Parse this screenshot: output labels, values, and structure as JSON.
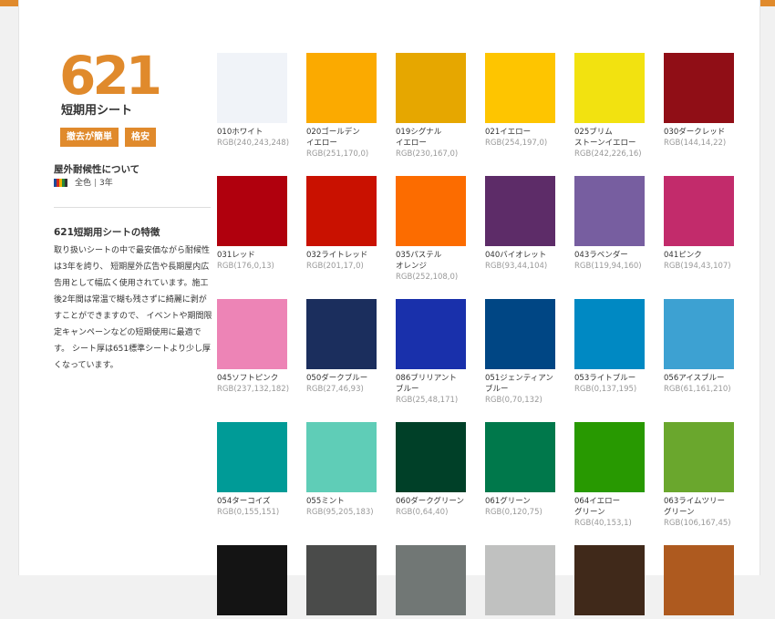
{
  "product": {
    "number": "621",
    "name": "短期用シート",
    "tags": [
      "撤去が簡単",
      "格安"
    ]
  },
  "weather": {
    "title": "屋外耐候性について",
    "colors": "全色",
    "years": "3年"
  },
  "feature": {
    "title": "621短期用シートの特徴",
    "text": "取り扱いシートの中で最安価ながら耐候性は3年を誇り、 短期屋外広告や長期屋内広告用として幅広く使用されています。施工後2年間は常温で糊も残さずに綺麗に剥がすことができますので、 イベントや期間限定キャンペーンなどの短期使用に最適です。 シート厚は651標準シートより少し厚くなっています。"
  },
  "swatches": [
    {
      "name": "010ホワイト",
      "rgb": "RGB(240,243,248)",
      "color": "#f0f3f8"
    },
    {
      "name": "020ゴールデン\nイエロー",
      "rgb": "RGB(251,170,0)",
      "color": "#fbaa00"
    },
    {
      "name": "019シグナル\nイエロー",
      "rgb": "RGB(230,167,0)",
      "color": "#e6a700"
    },
    {
      "name": "021イエロー",
      "rgb": "RGB(254,197,0)",
      "color": "#fec500"
    },
    {
      "name": "025ブリム\nストーンイエロー",
      "rgb": "RGB(242,226,16)",
      "color": "#f2e210"
    },
    {
      "name": "030ダークレッド",
      "rgb": "RGB(144,14,22)",
      "color": "#900e16"
    },
    {
      "name": "031レッド",
      "rgb": "RGB(176,0,13)",
      "color": "#b0000d"
    },
    {
      "name": "032ライトレッド",
      "rgb": "RGB(201,17,0)",
      "color": "#c91100"
    },
    {
      "name": "035パステル\nオレンジ",
      "rgb": "RGB(252,108,0)",
      "color": "#fc6c00"
    },
    {
      "name": "040バイオレット",
      "rgb": "RGB(93,44,104)",
      "color": "#5d2c68"
    },
    {
      "name": "043ラベンダー",
      "rgb": "RGB(119,94,160)",
      "color": "#775ea0"
    },
    {
      "name": "041ピンク",
      "rgb": "RGB(194,43,107)",
      "color": "#c22b6b"
    },
    {
      "name": "045ソフトピンク",
      "rgb": "RGB(237,132,182)",
      "color": "#ed84b6"
    },
    {
      "name": "050ダークブルー",
      "rgb": "RGB(27,46,93)",
      "color": "#1b2e5d"
    },
    {
      "name": "086ブリリアント\nブルー",
      "rgb": "RGB(25,48,171)",
      "color": "#1930ab"
    },
    {
      "name": "051ジェンティアン\nブルー",
      "rgb": "RGB(0,70,132)",
      "color": "#004684"
    },
    {
      "name": "053ライトブルー",
      "rgb": "RGB(0,137,195)",
      "color": "#0089c3"
    },
    {
      "name": "056アイスブルー",
      "rgb": "RGB(61,161,210)",
      "color": "#3da1d2"
    },
    {
      "name": "054ターコイズ",
      "rgb": "RGB(0,155,151)",
      "color": "#009b97"
    },
    {
      "name": "055ミント",
      "rgb": "RGB(95,205,183)",
      "color": "#5fcdb7"
    },
    {
      "name": "060ダークグリーン",
      "rgb": "RGB(0,64,40)",
      "color": "#004028"
    },
    {
      "name": "061グリーン",
      "rgb": "RGB(0,120,75)",
      "color": "#00784b"
    },
    {
      "name": "064イエロー\nグリーン",
      "rgb": "RGB(40,153,1)",
      "color": "#289901"
    },
    {
      "name": "063ライムツリー\nグリーン",
      "rgb": "RGB(106,167,45)",
      "color": "#6aa72d"
    },
    {
      "name": "",
      "rgb": "",
      "color": "#141414"
    },
    {
      "name": "",
      "rgb": "",
      "color": "#4a4b4a"
    },
    {
      "name": "",
      "rgb": "",
      "color": "#717775"
    },
    {
      "name": "",
      "rgb": "",
      "color": "#c0c1c0"
    },
    {
      "name": "",
      "rgb": "",
      "color": "#40291a"
    },
    {
      "name": "",
      "rgb": "",
      "color": "#ae5a1f"
    }
  ],
  "colors": {
    "accent": "#e08a2c",
    "weather_icon": [
      "#1f4b99",
      "#d42b1e",
      "#f0b400",
      "#2a8a3a",
      "#333333"
    ]
  }
}
